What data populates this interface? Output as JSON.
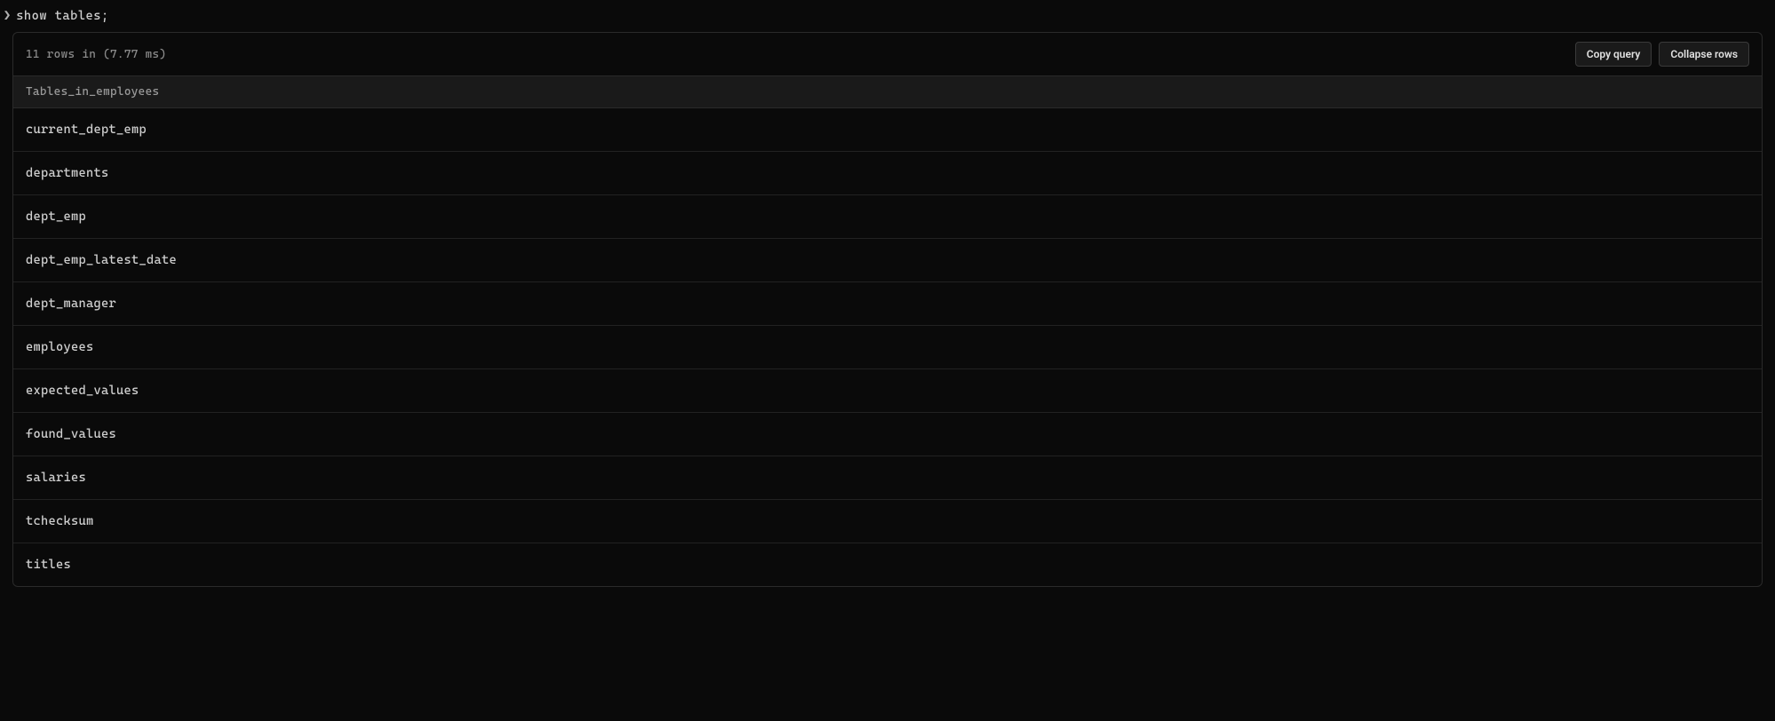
{
  "prompt": {
    "chevron": "❯",
    "query": "show tables;"
  },
  "result": {
    "stats": "11 rows in (7.77 ms)",
    "actions": {
      "copy_query": "Copy query",
      "collapse_rows": "Collapse rows"
    },
    "column_header": "Tables_in_employees",
    "rows": [
      "current_dept_emp",
      "departments",
      "dept_emp",
      "dept_emp_latest_date",
      "dept_manager",
      "employees",
      "expected_values",
      "found_values",
      "salaries",
      "tchecksum",
      "titles"
    ]
  }
}
